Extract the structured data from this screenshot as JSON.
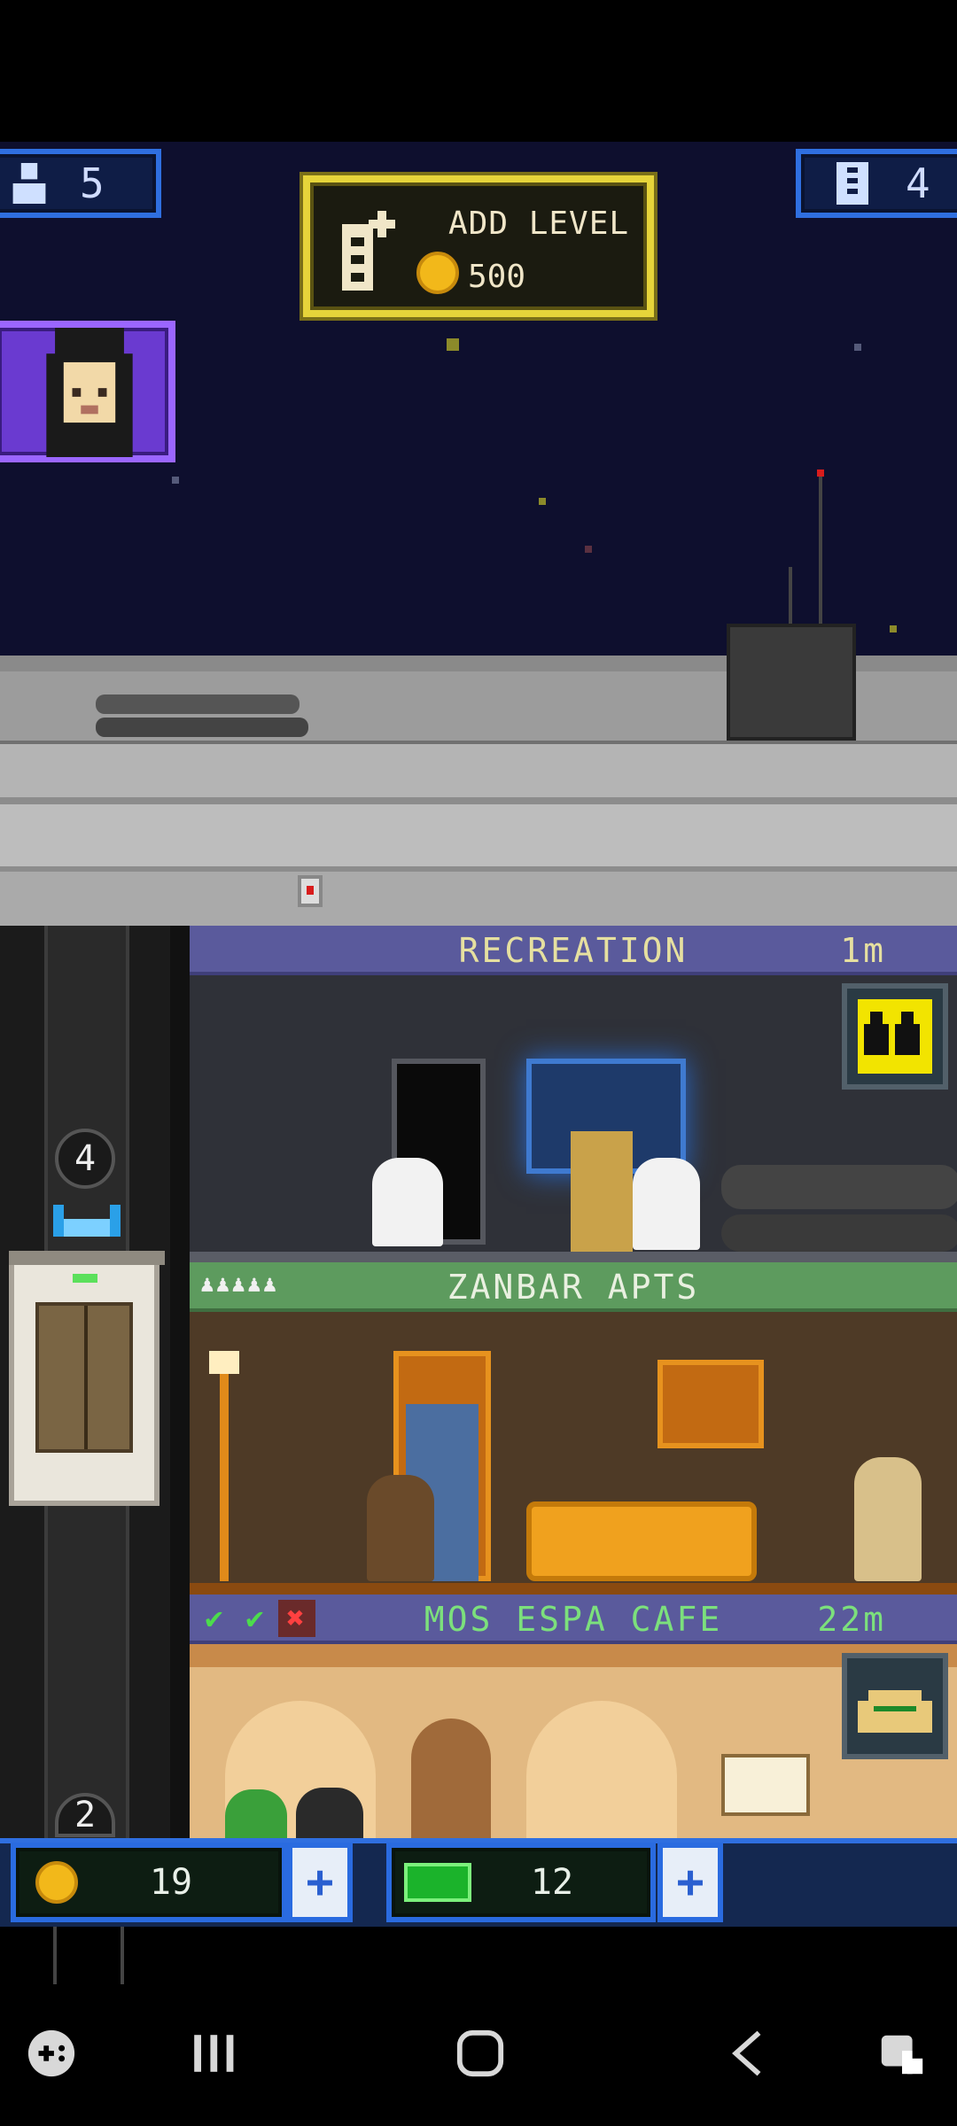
{
  "hud": {
    "population": "5",
    "floors": "4",
    "population_icon": "person-icon",
    "floors_icon": "building-icon"
  },
  "add_level": {
    "label": "ADD LEVEL",
    "cost": "500",
    "icon": "add-floor-icon"
  },
  "rooms": {
    "recreation": {
      "name": "RECREATION",
      "timer": "1m"
    },
    "zanbar": {
      "name": "ZANBAR APTS",
      "residents": "♟♟♟♟♟"
    },
    "cafe": {
      "name": "MOS ESPA CAFE",
      "timer": "22m"
    }
  },
  "elevator": {
    "floor_upper": "4",
    "floor_lower": "2"
  },
  "resources": {
    "coins": "19",
    "bux": "12",
    "plus": "+"
  },
  "colors": {
    "space": "#0e0f2e",
    "hud_border": "#2f6fe0",
    "add_level_border": "#e6d43a",
    "vip_purple": "#6a3ad0",
    "recreation_bar": "#5a5a9c",
    "residential_bar": "#5d9b5e"
  }
}
